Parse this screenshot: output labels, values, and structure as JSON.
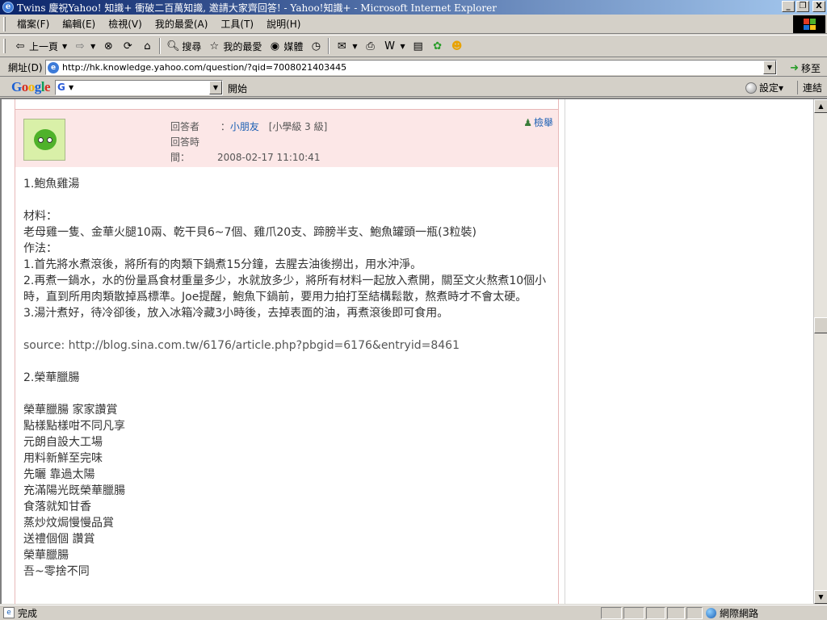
{
  "window": {
    "title": "Twins 慶祝Yahoo! 知識+ 衝破二百萬知識, 邀請大家齊回答! - Yahoo!知識+ - Microsoft Internet Explorer",
    "minimize": "_",
    "restore": "❐",
    "close": "X"
  },
  "menu": [
    "檔案(F)",
    "編輯(E)",
    "檢視(V)",
    "我的最愛(A)",
    "工具(T)",
    "說明(H)"
  ],
  "toolbar": {
    "back_label": "上一頁",
    "search_label": "搜尋",
    "favorites_label": "我的最愛",
    "media_label": "媒體"
  },
  "address": {
    "label": "網址(D)",
    "url": "http://hk.knowledge.yahoo.com/question/?qid=7008021403445",
    "go_label": "移至"
  },
  "googlebar": {
    "logo": "Google",
    "start_label": "開始",
    "settings_label": "設定▾",
    "links_label": "連結"
  },
  "answer": {
    "responder_label": "回答者",
    "responder_name": "小朋友",
    "responder_level": "[小學級 3 級]",
    "time_label": "回答時間：",
    "time_value": "2008-02-17 11:10:41",
    "report_label": "檢舉"
  },
  "content": {
    "lines": [
      "1.鮑魚雞湯",
      "",
      "材料：",
      "老母雞一隻、金華火腿10兩、乾干貝6~7個、雞爪20支、蹄膀半支、鮑魚罐頭一瓶(3粒裝)",
      "作法：",
      "1.首先將水煮滾後，將所有的肉類下鍋煮15分鐘，去腥去油後撈出，用水沖淨。",
      "2.再煮一鍋水，水的份量爲食材重量多少，水就放多少，將所有材料一起放入煮開，關至文火熬煮10個小時，直到所用肉類散掉爲標準。Joe提醒，鮑魚下鍋前，要用力拍打至結構鬆散，熬煮時才不會太硬。",
      "3.湯汁煮好，待冷卻後，放入冰箱冷藏3小時後，去掉表面的油，再煮滾後即可食用。",
      "",
      "source: http://blog.sina.com.tw/6176/article.php?pbgid=6176&entryid=8461",
      "",
      "2.榮華臘腸",
      "",
      "榮華臘腸 家家讚賞",
      "點樣點樣咁不同凡享",
      "元朗自設大工場",
      "用料新鮮至完味",
      "先曬 靠過太陽",
      "充滿陽光既榮華臘腸",
      "食落就知甘香",
      "蒸炒炆焗慢慢品賞",
      "送禮個個 讚賞",
      "榮華臘腸",
      "吾~零捨不同"
    ]
  },
  "status": {
    "text": "完成",
    "zone": "網際網路"
  }
}
